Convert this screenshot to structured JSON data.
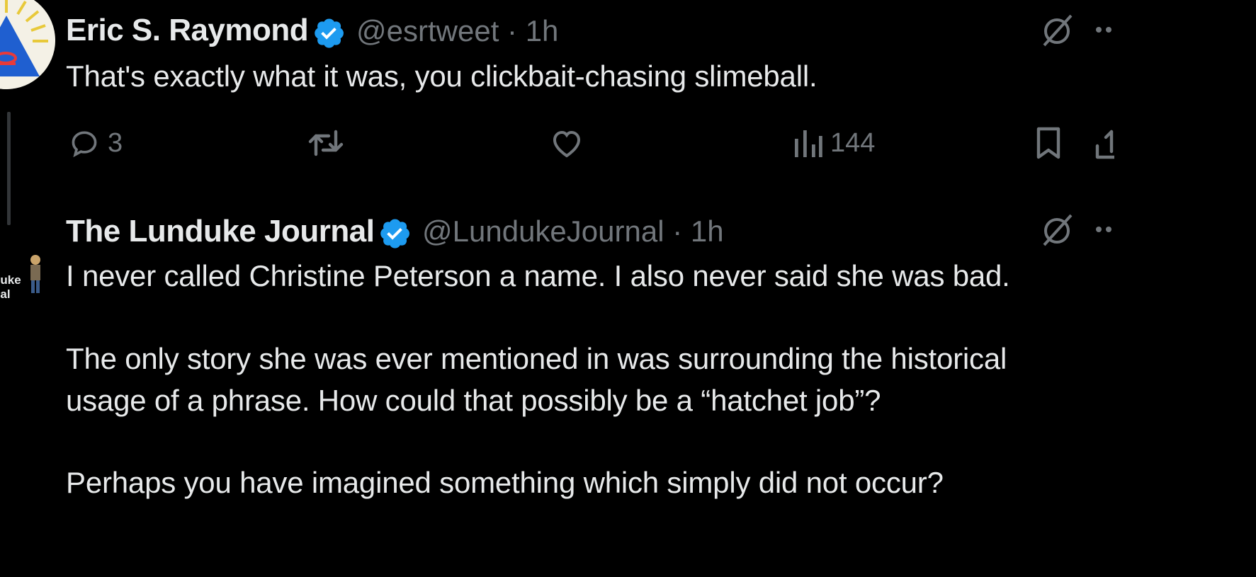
{
  "tweets": [
    {
      "display_name": "Eric S. Raymond",
      "handle": "@esrtweet",
      "time": "· 1h",
      "text": "That's exactly what it was, you clickbait-chasing slimeball.",
      "actions": {
        "replies": "3",
        "retweets": "",
        "likes": "",
        "views": "144"
      }
    },
    {
      "display_name": "The Lunduke Journal",
      "handle": "@LundukeJournal",
      "time": "· 1h",
      "avatar_text": "duke\nnal",
      "text_lines": [
        "I never called Christine Peterson a name.  I also never said she was bad.",
        "The only story she was ever mentioned in was surrounding the historical",
        "usage of a phrase.  How could that possibly be a “hatchet job”?",
        "Perhaps you have imagined something which simply did not occur?"
      ]
    }
  ],
  "colors": {
    "background": "#000000",
    "text": "#e7e9ea",
    "secondary": "#71767b",
    "verified": "#1d9bf0"
  },
  "icons": {
    "reply": "reply-icon",
    "retweet": "retweet-icon",
    "like": "heart-icon",
    "views": "views-icon",
    "bookmark": "bookmark-icon",
    "share": "share-icon",
    "grok": "grok-icon",
    "more": "more-icon"
  }
}
